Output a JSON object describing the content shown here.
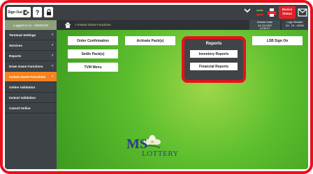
{
  "topbar": {
    "signout_label": "Sign Out",
    "help_label": "?",
    "device_status_label": "Device Status"
  },
  "subbar": {
    "logged_in": "Logged In As - 52001100",
    "breadcrumb": "Instant Game Functions",
    "info1": [
      "Retailer Date",
      "04-15-2020",
      "10:32:47"
    ],
    "info2": [
      "Login Retailer",
      "03 - 15 - 10000"
    ]
  },
  "sidebar": {
    "items": [
      {
        "label": "Terminal Settings",
        "arrow": true
      },
      {
        "label": "Services",
        "arrow": true
      },
      {
        "label": "Reports",
        "arrow": true
      },
      {
        "label": "Draw Game Functions",
        "arrow": true
      },
      {
        "label": "Instant Game Functions",
        "arrow": true,
        "active": true
      },
      {
        "label": "Online Validation",
        "arrow": false
      },
      {
        "label": "Instant Validation",
        "arrow": false
      },
      {
        "label": "Cancel Online",
        "arrow": false
      }
    ]
  },
  "main": {
    "tiles": {
      "order_confirmation": "Order Confirmation",
      "activate_packs": "Activate Pack(s)",
      "lsb_sign_on": "LSB Sign On",
      "settle_packs": "Settle Pack(s)",
      "tvm_menu": "TVM Menu"
    },
    "reports": {
      "title": "Reports",
      "inventory": "Inventory Reports",
      "financial": "Financial Reports"
    },
    "logo": {
      "ms": "MS",
      "lottery": "LOTTERY"
    }
  },
  "colors": {
    "highlight_red": "#e8101c",
    "active_orange": "#f58220",
    "sage": "#8da07a",
    "background_green": "#5cbe2d"
  }
}
